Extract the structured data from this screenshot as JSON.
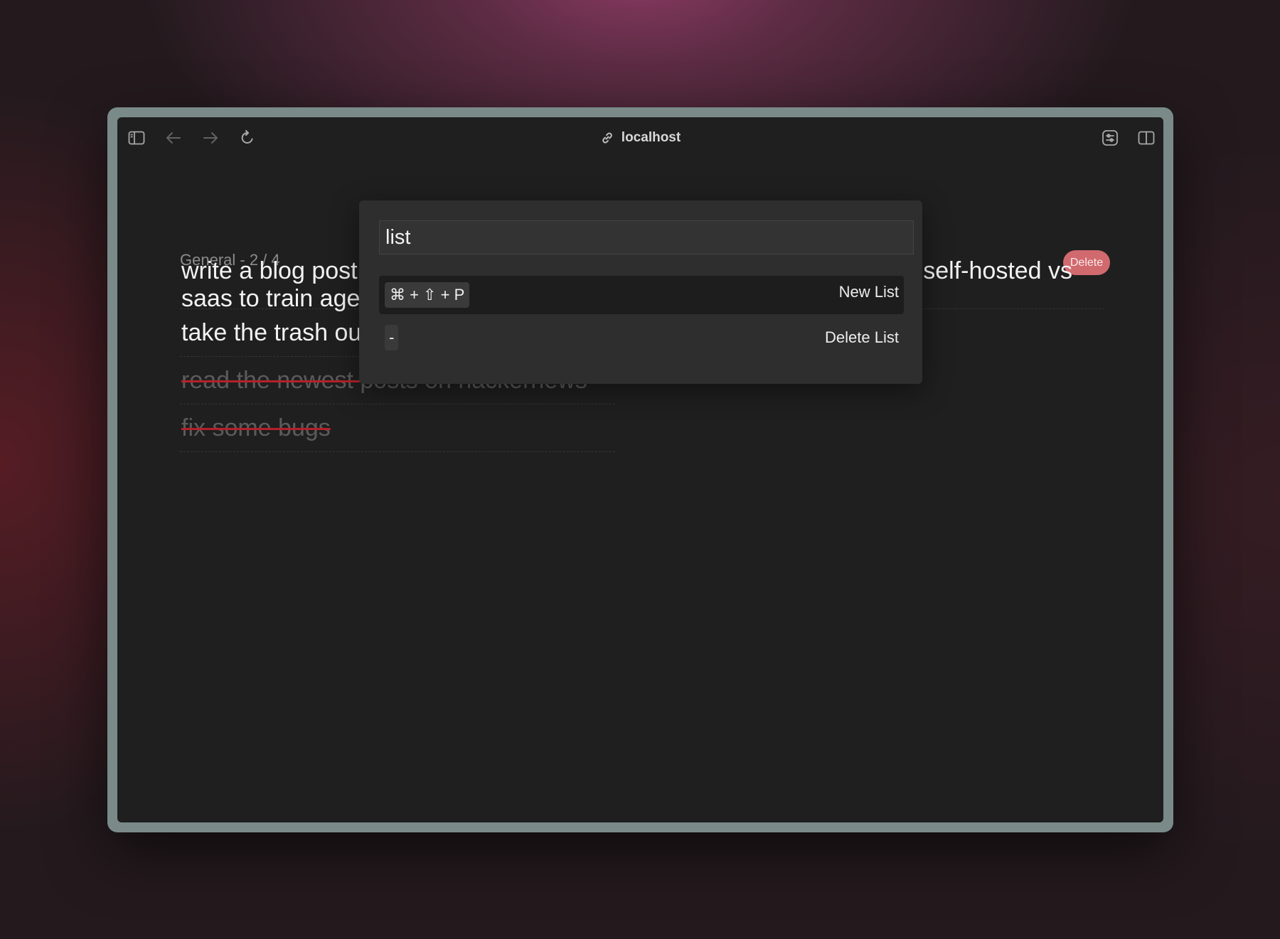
{
  "browser": {
    "address": "localhost",
    "icons": {
      "sidebar": "sidebar-toggle-icon",
      "back": "arrow-left-icon",
      "forward": "arrow-right-icon",
      "reload": "reload-icon",
      "link": "link-icon",
      "extension": "extension-icon",
      "split": "split-view-icon"
    }
  },
  "list": {
    "header": "General - 2 / 4",
    "delete_label": "Delete",
    "delete_color": "#d16a6f",
    "items": [
      {
        "text": "write a blog post about the pros and cons of using in-house mlops vs self-hosted vs saas to train agents",
        "done": false
      },
      {
        "text": "take the trash out",
        "done": false
      },
      {
        "text": "read the newest posts on hackernews",
        "done": true
      },
      {
        "text": "fix some bugs",
        "done": true
      }
    ]
  },
  "palette": {
    "query": "list",
    "commands": [
      {
        "shortcut": "⌘ + ⇧ + P",
        "label": "New List",
        "selected": true
      },
      {
        "shortcut": "-",
        "label": "Delete List",
        "selected": false
      }
    ]
  }
}
